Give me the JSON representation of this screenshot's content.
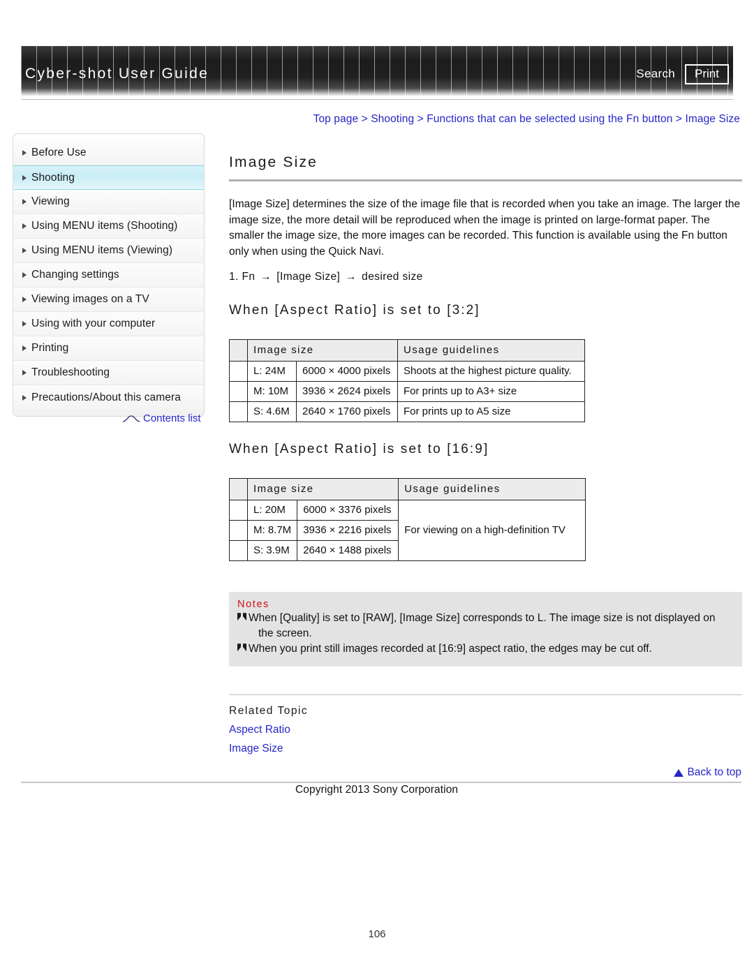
{
  "header": {
    "title": "Cyber-shot User Guide",
    "search_label": "Search",
    "print_label": "Print"
  },
  "breadcrumb": {
    "items": [
      "Top page",
      "Shooting",
      "Functions that can be selected using the Fn button",
      "Image Size"
    ],
    "separator": ">",
    "full_text": "Top page > Shooting > Functions that can be selected using the Fn button > Image Size"
  },
  "sidebar": {
    "items": [
      {
        "label": "Before Use",
        "active": false
      },
      {
        "label": "Shooting",
        "active": true
      },
      {
        "label": "Viewing",
        "active": false
      },
      {
        "label": "Using MENU items (Shooting)",
        "active": false
      },
      {
        "label": "Using MENU items (Viewing)",
        "active": false
      },
      {
        "label": "Changing settings",
        "active": false
      },
      {
        "label": "Viewing images on a TV",
        "active": false
      },
      {
        "label": "Using with your computer",
        "active": false
      },
      {
        "label": "Printing",
        "active": false
      },
      {
        "label": "Troubleshooting",
        "active": false
      },
      {
        "label": "Precautions/About this camera",
        "active": false
      }
    ],
    "contents_link": "Contents list"
  },
  "main": {
    "title": "Image Size",
    "intro": "[Image Size] determines the size of the image file that is recorded when you take an image. The larger the image size, the more detail will be reproduced when the image is printed on large-format paper. The smaller the image size, the more images can be recorded. This function is available using the Fn button only when using the Quick Navi.",
    "step": {
      "number": "1.",
      "part1": "Fn",
      "part2": "[Image Size]",
      "part3": "desired size",
      "arrow": "→"
    },
    "section_32": {
      "heading": "When [Aspect Ratio] is set to [3:2]",
      "headers": {
        "lead": "",
        "image_size": "Image size",
        "usage": "Usage guidelines"
      },
      "rows": [
        {
          "label": "L: 24M",
          "pixels": "6000 × 4000 pixels",
          "usage": "Shoots at the highest picture quality."
        },
        {
          "label": "M: 10M",
          "pixels": "3936 × 2624 pixels",
          "usage": "For prints up to A3+ size"
        },
        {
          "label": "S: 4.6M",
          "pixels": "2640 × 1760 pixels",
          "usage": "For prints up to A5 size"
        }
      ]
    },
    "section_169": {
      "heading": "When [Aspect Ratio] is set to [16:9]",
      "headers": {
        "lead": "",
        "image_size": "Image size",
        "usage": "Usage guidelines"
      },
      "rows": [
        {
          "label": "L: 20M",
          "pixels": "6000 × 3376 pixels"
        },
        {
          "label": "M: 8.7M",
          "pixels": "3936 × 2216 pixels"
        },
        {
          "label": "S: 3.9M",
          "pixels": "2640 × 1488 pixels"
        }
      ],
      "usage_merged": "For viewing on a high-definition TV"
    },
    "notes": {
      "title": "Notes",
      "items": [
        "When [Quality] is set to [RAW], [Image Size] corresponds to L. The image size is not displayed on the screen.",
        "When you print still images recorded at [16:9] aspect ratio, the edges may be cut off."
      ],
      "item0_line1": "When [Quality] is set to [RAW], [Image Size] corresponds to L. The image size is not displayed on",
      "item0_line2": "the screen.",
      "item1_line1": "When you print still images recorded at [16:9] aspect ratio, the edges may be cut off."
    },
    "related": {
      "title": "Related Topic",
      "links": [
        "Aspect Ratio",
        "Image Size"
      ]
    }
  },
  "footer": {
    "back_to_top": "Back to top",
    "copyright": "Copyright 2013 Sony Corporation",
    "page_number": "106"
  },
  "colors": {
    "link_blue": "#2626c8",
    "notes_red": "#d01010",
    "active_sidebar": "#c9edf6",
    "table_header_gray": "#ececec",
    "notes_bg": "#e3e3e3"
  }
}
